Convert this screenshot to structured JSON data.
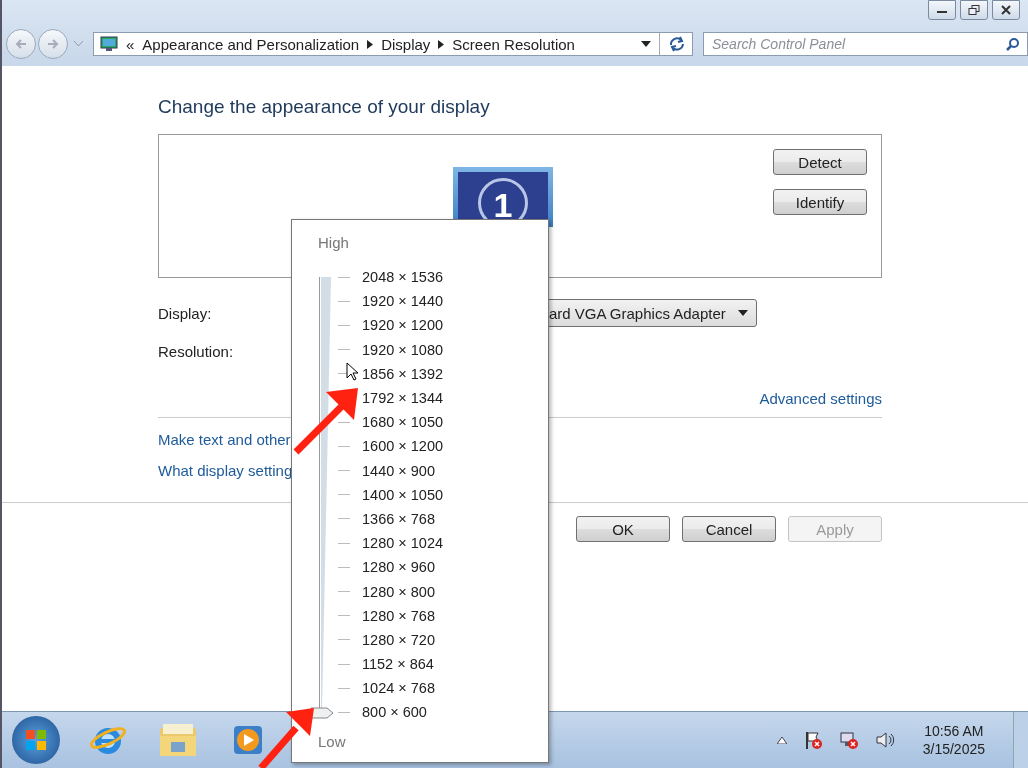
{
  "address_bar": {
    "overflow": "«",
    "breadcrumbs": [
      "Appearance and Personalization",
      "Display",
      "Screen Resolution"
    ]
  },
  "search": {
    "placeholder": "Search Control Panel"
  },
  "heading": "Change the appearance of your display",
  "monitor_panel": {
    "monitor_number": "1",
    "buttons": [
      "Detect",
      "Identify"
    ]
  },
  "display": {
    "label": "Display:",
    "value": "ard VGA Graphics Adapter"
  },
  "resolution": {
    "label": "Resolution:"
  },
  "advanced_link": "Advanced settings",
  "links": [
    "Make text and other",
    "What display setting"
  ],
  "buttons": [
    {
      "label": "OK",
      "disabled": false
    },
    {
      "label": "Cancel",
      "disabled": false
    },
    {
      "label": "Apply",
      "disabled": true
    }
  ],
  "resolution_popup": {
    "high": "High",
    "low": "Low",
    "slider": {
      "level": 0
    },
    "options": [
      "2048 × 1536",
      "1920 × 1440",
      "1920 × 1200",
      "1920 × 1080",
      "1856 × 1392",
      "1792 × 1344",
      "1680 × 1050",
      "1600 × 1200",
      "1440 × 900",
      "1400 × 1050",
      "1366 × 768",
      "1280 × 1024",
      "1280 × 960",
      "1280 × 800",
      "1280 × 768",
      "1280 × 720",
      "1152 × 864",
      "1024 × 768",
      "800 × 600"
    ]
  },
  "taskbar": {
    "time": "10:56 AM",
    "date": "3/15/2025"
  }
}
